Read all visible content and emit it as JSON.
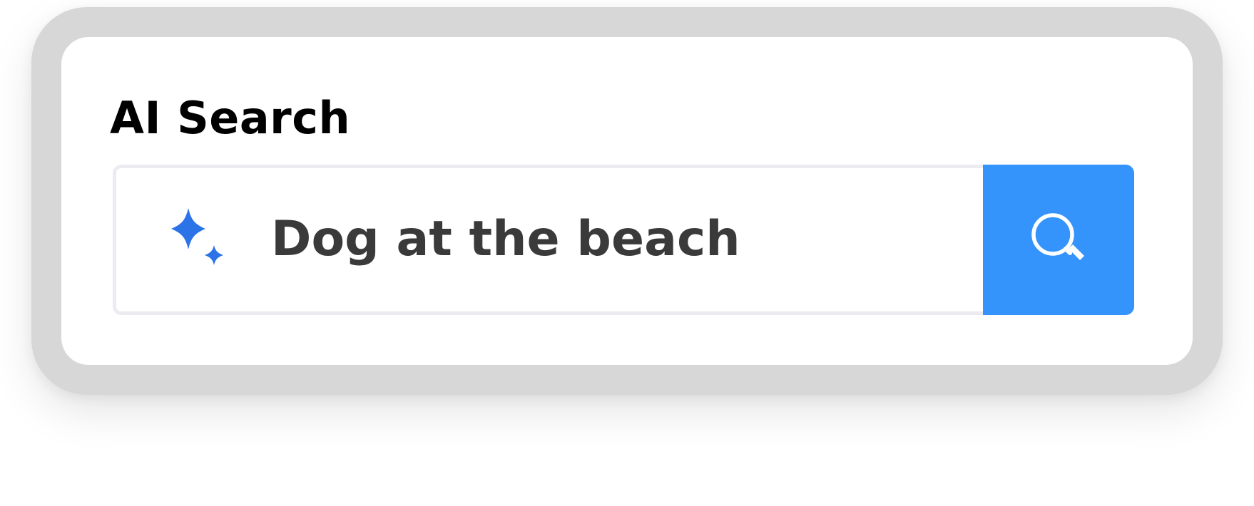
{
  "widget": {
    "title": "AI Search",
    "query_value": "Dog at the beach"
  },
  "icons": {
    "ai": "sparkle-icon",
    "search": "magnifier-icon"
  },
  "colors": {
    "accent": "#3494fb",
    "sparkle": "#2c73e8",
    "frame": "#d7d7d7",
    "input_border": "#ebebf1",
    "query_text": "#3a3a3a"
  }
}
